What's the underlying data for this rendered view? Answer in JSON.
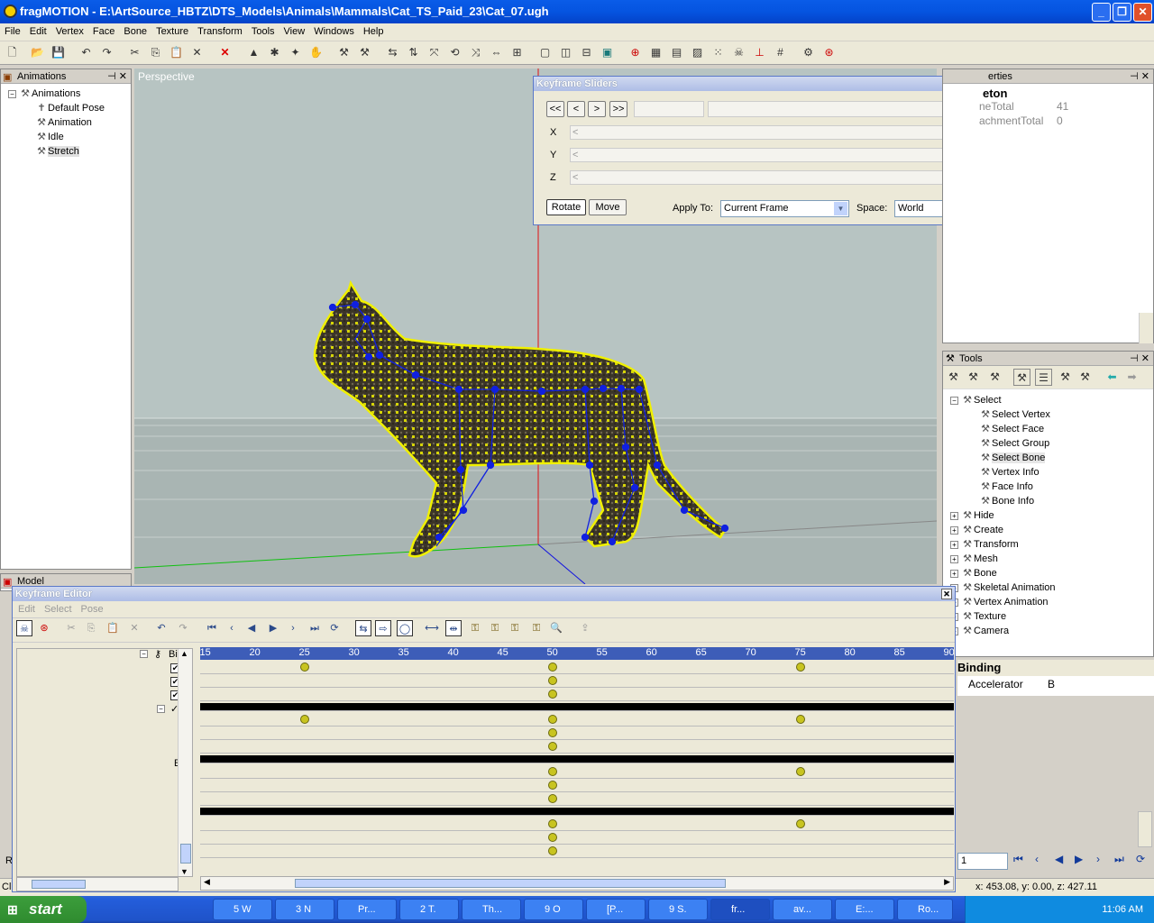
{
  "window": {
    "title": "fragMOTION - E:\\ArtSource_HBTZ\\DTS_Models\\Animals\\Mammals\\Cat_TS_Paid_23\\Cat_07.ugh",
    "min": "_",
    "max": "❐",
    "close": "✕"
  },
  "menu": [
    "File",
    "Edit",
    "Vertex",
    "Face",
    "Bone",
    "Texture",
    "Transform",
    "Tools",
    "View",
    "Windows",
    "Help"
  ],
  "animations_panel": {
    "title": "Animations",
    "pin": "⊣ ✕",
    "root": "Animations",
    "items": [
      "Default Pose",
      "Animation",
      "Idle",
      "Stretch"
    ],
    "selected": "Stretch"
  },
  "model_panel": {
    "title": "Model"
  },
  "viewport": {
    "label": "Perspective"
  },
  "keyframe_sliders": {
    "title": "Keyframe Sliders",
    "nav": [
      "<<",
      "<",
      ">",
      ">>"
    ],
    "axes": [
      "X",
      "Y",
      "Z"
    ],
    "rotate": "Rotate",
    "move": "Move",
    "apply_to_label": "Apply To:",
    "apply_to_value": "Current Frame",
    "space_label": "Space:",
    "space_value": "World",
    "arrow_left": "<",
    "arrow_right": ">"
  },
  "properties_panel": {
    "title": "erties",
    "heading": "eton",
    "rows": [
      {
        "k": "neTotal",
        "v": "41"
      },
      {
        "k": "achmentTotal",
        "v": "0"
      }
    ]
  },
  "tools_panel": {
    "title": "Tools",
    "items": [
      {
        "label": "Select",
        "level": 0,
        "expander": "−"
      },
      {
        "label": "Select Vertex",
        "level": 1
      },
      {
        "label": "Select Face",
        "level": 1
      },
      {
        "label": "Select Group",
        "level": 1
      },
      {
        "label": "Select Bone",
        "level": 1
      },
      {
        "label": "Vertex Info",
        "level": 1
      },
      {
        "label": "Face Info",
        "level": 1
      },
      {
        "label": "Bone Info",
        "level": 1
      },
      {
        "label": "Hide",
        "level": 0,
        "expander": "+"
      },
      {
        "label": "Create",
        "level": 0,
        "expander": "+"
      },
      {
        "label": "Transform",
        "level": 0,
        "expander": "+"
      },
      {
        "label": "Mesh",
        "level": 0,
        "expander": "+"
      },
      {
        "label": "Bone",
        "level": 0,
        "expander": "+"
      },
      {
        "label": "Skeletal Animation",
        "level": 0,
        "expander": "+"
      },
      {
        "label": "Vertex Animation",
        "level": 0,
        "expander": "+"
      },
      {
        "label": "Texture",
        "level": 0,
        "expander": "+"
      },
      {
        "label": "Camera",
        "level": 0,
        "expander": "+"
      }
    ],
    "selected": "Select Bone"
  },
  "binding": {
    "title": "Binding",
    "key": "Accelerator",
    "value": "B"
  },
  "frame": {
    "value": "1"
  },
  "status": {
    "coords": "x: 453.08, y: 0.00, z: 427.11",
    "left": "Cl",
    "small_r": "R"
  },
  "keyframe_editor": {
    "title": "Keyframe Editor",
    "menu": [
      "Edit",
      "Select",
      "Pose"
    ],
    "tree_label_top": "Bi",
    "tree_label_mid": "E",
    "ticks": [
      "15",
      "20",
      "25",
      "30",
      "35",
      "40",
      "45",
      "50",
      "55",
      "60",
      "65",
      "70",
      "75",
      "80",
      "85",
      "90"
    ],
    "rows": [
      {
        "type": "track",
        "keys": [
          25,
          50,
          75
        ]
      },
      {
        "type": "track",
        "keys": [
          50
        ]
      },
      {
        "type": "track",
        "keys": [
          50
        ]
      },
      {
        "type": "group",
        "keys": []
      },
      {
        "type": "track",
        "keys": [
          25,
          50,
          75
        ]
      },
      {
        "type": "track",
        "keys": [
          50
        ]
      },
      {
        "type": "track",
        "keys": [
          50
        ]
      },
      {
        "type": "group",
        "keys": []
      },
      {
        "type": "track",
        "keys": [
          50,
          75
        ]
      },
      {
        "type": "track",
        "keys": [
          50
        ]
      },
      {
        "type": "track",
        "keys": [
          50
        ]
      },
      {
        "type": "group",
        "keys": []
      },
      {
        "type": "track",
        "keys": [
          50,
          75
        ]
      },
      {
        "type": "track",
        "keys": [
          50
        ]
      },
      {
        "type": "track",
        "keys": [
          50
        ]
      }
    ]
  },
  "taskbar": {
    "start": "start",
    "tasks": [
      "5 W",
      "3 N",
      "Pr...",
      "2 T.",
      "Th...",
      "9 O",
      "[P...",
      "9 S.",
      "fr...",
      "av...",
      "E:...",
      "Ro..."
    ],
    "active": "fr...",
    "clock": "11:06 AM"
  },
  "colors": {
    "titlebar": "#0554e0",
    "viewport": "#b7c4c2",
    "key": "#c8c420",
    "bone": "#1020e0",
    "vertex": "#f0f000"
  }
}
